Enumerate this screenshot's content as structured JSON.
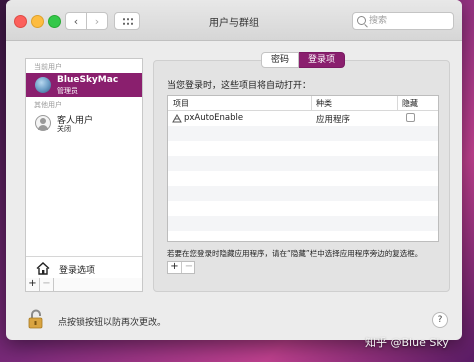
{
  "window": {
    "title": "用户与群组"
  },
  "search": {
    "placeholder": "搜索"
  },
  "sidebar": {
    "current_users_header": "当前用户",
    "current_user": {
      "name": "BlueSkyMac",
      "role": "管理员"
    },
    "other_users_header": "其他用户",
    "other_user": {
      "name": "客人用户",
      "role": "关闭"
    },
    "login_options_label": "登录选项",
    "add_symbol": "+",
    "remove_symbol": "−"
  },
  "tabs": [
    {
      "label": "密码",
      "active": false
    },
    {
      "label": "登录项",
      "active": true
    }
  ],
  "panel": {
    "heading": "当您登录时，这些项目将自动打开：",
    "columns": [
      "项目",
      "种类",
      "隐藏"
    ],
    "rows": [
      {
        "name": "pxAutoEnable",
        "kind": "应用程序",
        "hidden": false
      }
    ],
    "note": "若要在您登录时隐藏应用程序，请在“隐藏”栏中选择应用程序旁边的复选框。",
    "add_symbol": "+",
    "remove_symbol": "−"
  },
  "footer": {
    "lock_text": "点按锁按钮以防再次更改。",
    "help_symbol": "?"
  },
  "watermark": "知乎 @Blue Sky",
  "colors": {
    "accent": "#8a1f6e"
  }
}
